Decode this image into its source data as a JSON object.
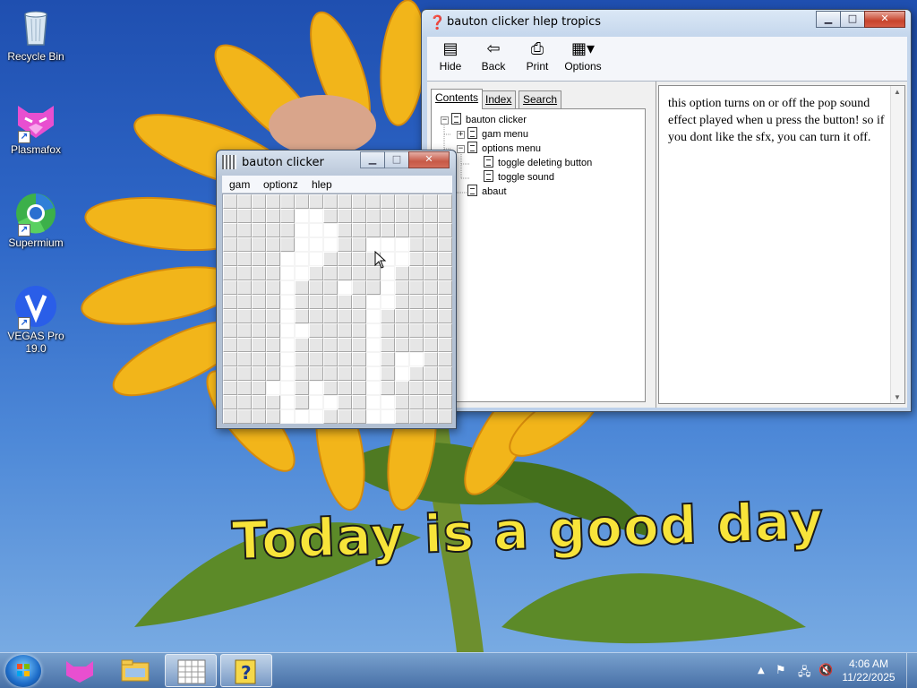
{
  "desktop": {
    "wallpaper_caption": "Today is a good day",
    "icons": [
      {
        "label": "Recycle Bin",
        "icon": "recycle-bin-icon"
      },
      {
        "label": "Plasmafox",
        "icon": "plasmafox-icon"
      },
      {
        "label": "Supermium",
        "icon": "supermium-icon"
      },
      {
        "label": "VEGAS Pro 19.0",
        "icon": "vegas-pro-icon"
      }
    ]
  },
  "help_window": {
    "title": "bauton clicker hlep tropics",
    "toolbar": [
      {
        "label": "Hide",
        "icon": "hide-icon"
      },
      {
        "label": "Back",
        "icon": "back-arrow-icon"
      },
      {
        "label": "Print",
        "icon": "print-icon"
      },
      {
        "label": "Options",
        "icon": "options-icon"
      }
    ],
    "tabs": [
      "Contents",
      "Index",
      "Search"
    ],
    "active_tab": "Contents",
    "tree": [
      {
        "label": "bauton clicker",
        "level": 0,
        "expanded": true
      },
      {
        "label": "gam menu",
        "level": 1,
        "expanded": false
      },
      {
        "label": "options menu",
        "level": 1,
        "expanded": true
      },
      {
        "label": "toggle deleting button",
        "level": 2
      },
      {
        "label": "toggle sound",
        "level": 2
      },
      {
        "label": "abaut",
        "level": 1
      }
    ],
    "content": "this option turns on or off the pop sound effect played when u press the button! so if you dont like the sfx, you can turn it off."
  },
  "clicker_window": {
    "title": "bauton clicker",
    "menu": [
      "gam",
      "optionz",
      "hlep"
    ],
    "grid_size": 16,
    "removed_cells": [
      [
        1,
        5
      ],
      [
        1,
        6
      ],
      [
        2,
        5
      ],
      [
        2,
        6
      ],
      [
        3,
        5
      ],
      [
        3,
        6
      ],
      [
        3,
        7
      ],
      [
        4,
        4
      ],
      [
        4,
        5
      ],
      [
        4,
        6
      ],
      [
        5,
        4
      ],
      [
        5,
        5
      ],
      [
        6,
        4
      ],
      [
        7,
        4
      ],
      [
        8,
        4
      ],
      [
        9,
        4
      ],
      [
        10,
        4
      ],
      [
        11,
        4
      ],
      [
        12,
        4
      ],
      [
        13,
        4
      ],
      [
        14,
        4
      ],
      [
        15,
        4
      ],
      [
        15,
        5
      ],
      [
        15,
        6
      ],
      [
        14,
        6
      ],
      [
        13,
        6
      ],
      [
        3,
        10
      ],
      [
        3,
        11
      ],
      [
        3,
        12
      ],
      [
        4,
        11
      ],
      [
        4,
        12
      ],
      [
        5,
        11
      ],
      [
        6,
        11
      ],
      [
        7,
        10
      ],
      [
        7,
        11
      ],
      [
        8,
        10
      ],
      [
        9,
        10
      ],
      [
        10,
        10
      ],
      [
        11,
        10
      ],
      [
        12,
        10
      ],
      [
        13,
        10
      ],
      [
        14,
        10
      ],
      [
        15,
        10
      ],
      [
        15,
        11
      ],
      [
        14,
        11
      ],
      [
        11,
        12
      ],
      [
        12,
        12
      ],
      [
        2,
        7
      ],
      [
        14,
        7
      ],
      [
        9,
        5
      ],
      [
        13,
        3
      ],
      [
        6,
        8
      ],
      [
        11,
        13
      ]
    ]
  },
  "taskbar": {
    "apps": [
      "start-orb-icon",
      "plasmafox-icon",
      "file-explorer-icon",
      "bauton-clicker-icon",
      "help-icon"
    ],
    "time": "4:06 AM",
    "date": "11/22/2025",
    "tray_icons": [
      "show-hidden-icons-icon",
      "action-center-icon",
      "network-icon",
      "volume-muted-icon"
    ]
  },
  "colors": {
    "wallpaper_sky": "#2f68c8",
    "caption_yellow": "#f8e43a",
    "close_red": "#c7442c"
  }
}
